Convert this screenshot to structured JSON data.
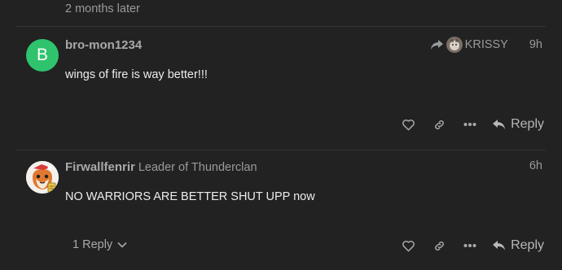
{
  "gap": {
    "label": "2 months later"
  },
  "posts": [
    {
      "avatar_letter": "B",
      "avatar_color": "#2fc36d",
      "username": "bro-mon1234",
      "reply_to_user": "KRISSY",
      "time": "9h",
      "body": "wings of fire is way better!!!",
      "reply_label": "Reply"
    },
    {
      "username": "Firwallfenrir",
      "user_title": "Leader of Thunderclan",
      "time": "6h",
      "body": "NO WARRIORS ARE BETTER SHUT UPP now",
      "replies_count_label": "1 Reply",
      "reply_label": "Reply"
    }
  ],
  "icons": {
    "like": "heart-icon",
    "copy_link": "link-icon",
    "more": "ellipsis-icon",
    "reply": "reply-arrow-icon",
    "reply_to": "share-arrow-icon",
    "expand": "chevron-down-icon"
  }
}
